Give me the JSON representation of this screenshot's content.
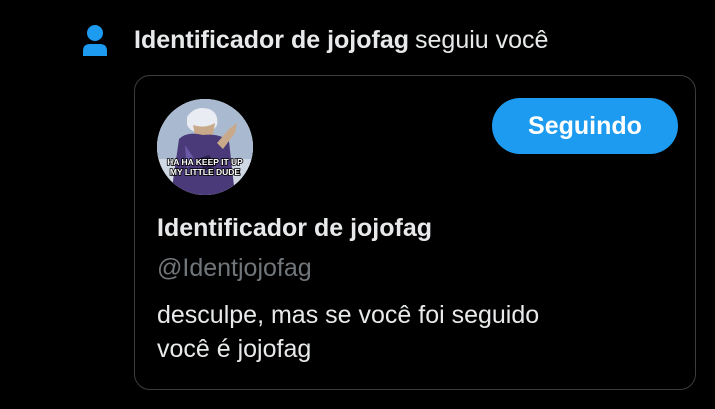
{
  "notification": {
    "user_name": "Identificador de jojofag",
    "action_text": "seguiu você",
    "icon": "person-icon",
    "icon_color": "#1d9bf0"
  },
  "card": {
    "avatar_caption_line1": "HA HA KEEP IT UP",
    "avatar_caption_line2": "MY LITTLE DUDE",
    "follow_button_label": "Seguindo",
    "display_name": "Identificador de jojofag",
    "handle": "@Identjojofag",
    "bio_line1": "desculpe, mas se você foi seguido",
    "bio_line2": "você é jojofag"
  },
  "colors": {
    "background": "#000000",
    "text_primary": "#e7e9ea",
    "text_secondary": "#71767b",
    "accent": "#1d9bf0",
    "border": "#3a3d40"
  }
}
